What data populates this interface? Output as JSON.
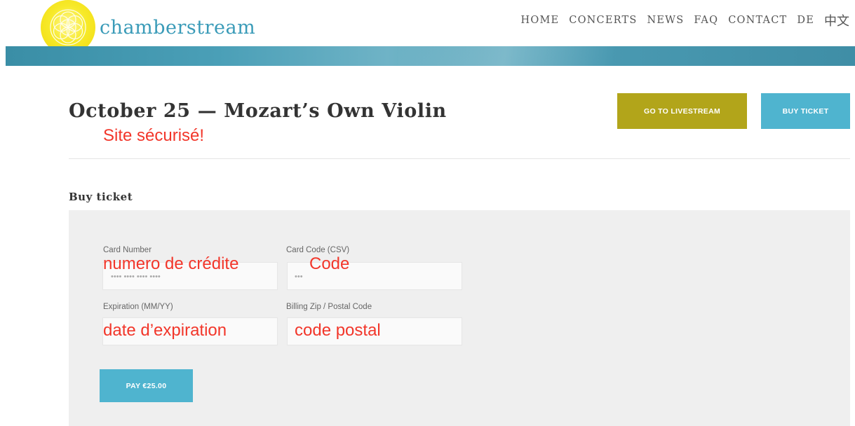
{
  "header": {
    "brand": "chamberstream",
    "nav": [
      "HOME",
      "CONCERTS",
      "NEWS",
      "FAQ",
      "CONTACT",
      "DE",
      "中文"
    ]
  },
  "page": {
    "title": "October 25 — Mozart’s Own Violin",
    "secure_note": "Site sécurisé!",
    "livestream_button": "GO TO LIVESTREAM",
    "buy_button": "BUY TICKET",
    "section_title": "Buy ticket"
  },
  "form": {
    "card_number": {
      "label": "Card Number",
      "placeholder": "•••• •••• •••• ••••",
      "overlay": "numero de crédite"
    },
    "card_code": {
      "label": "Card Code (CSV)",
      "placeholder": "•••",
      "overlay": "Code"
    },
    "expiration": {
      "label": "Expiration (MM/YY)",
      "overlay": "date d’expiration"
    },
    "zip": {
      "label": "Billing Zip / Postal Code",
      "overlay": "code postal"
    },
    "pay_button": "PAY €25.00"
  },
  "colors": {
    "accent_blue": "#4fb4cf",
    "accent_olive": "#b2a51a",
    "annotation_red": "#f2362a",
    "logo_yellow": "#f1d90c"
  },
  "icons": {
    "logo": "flower-of-life-logo"
  }
}
